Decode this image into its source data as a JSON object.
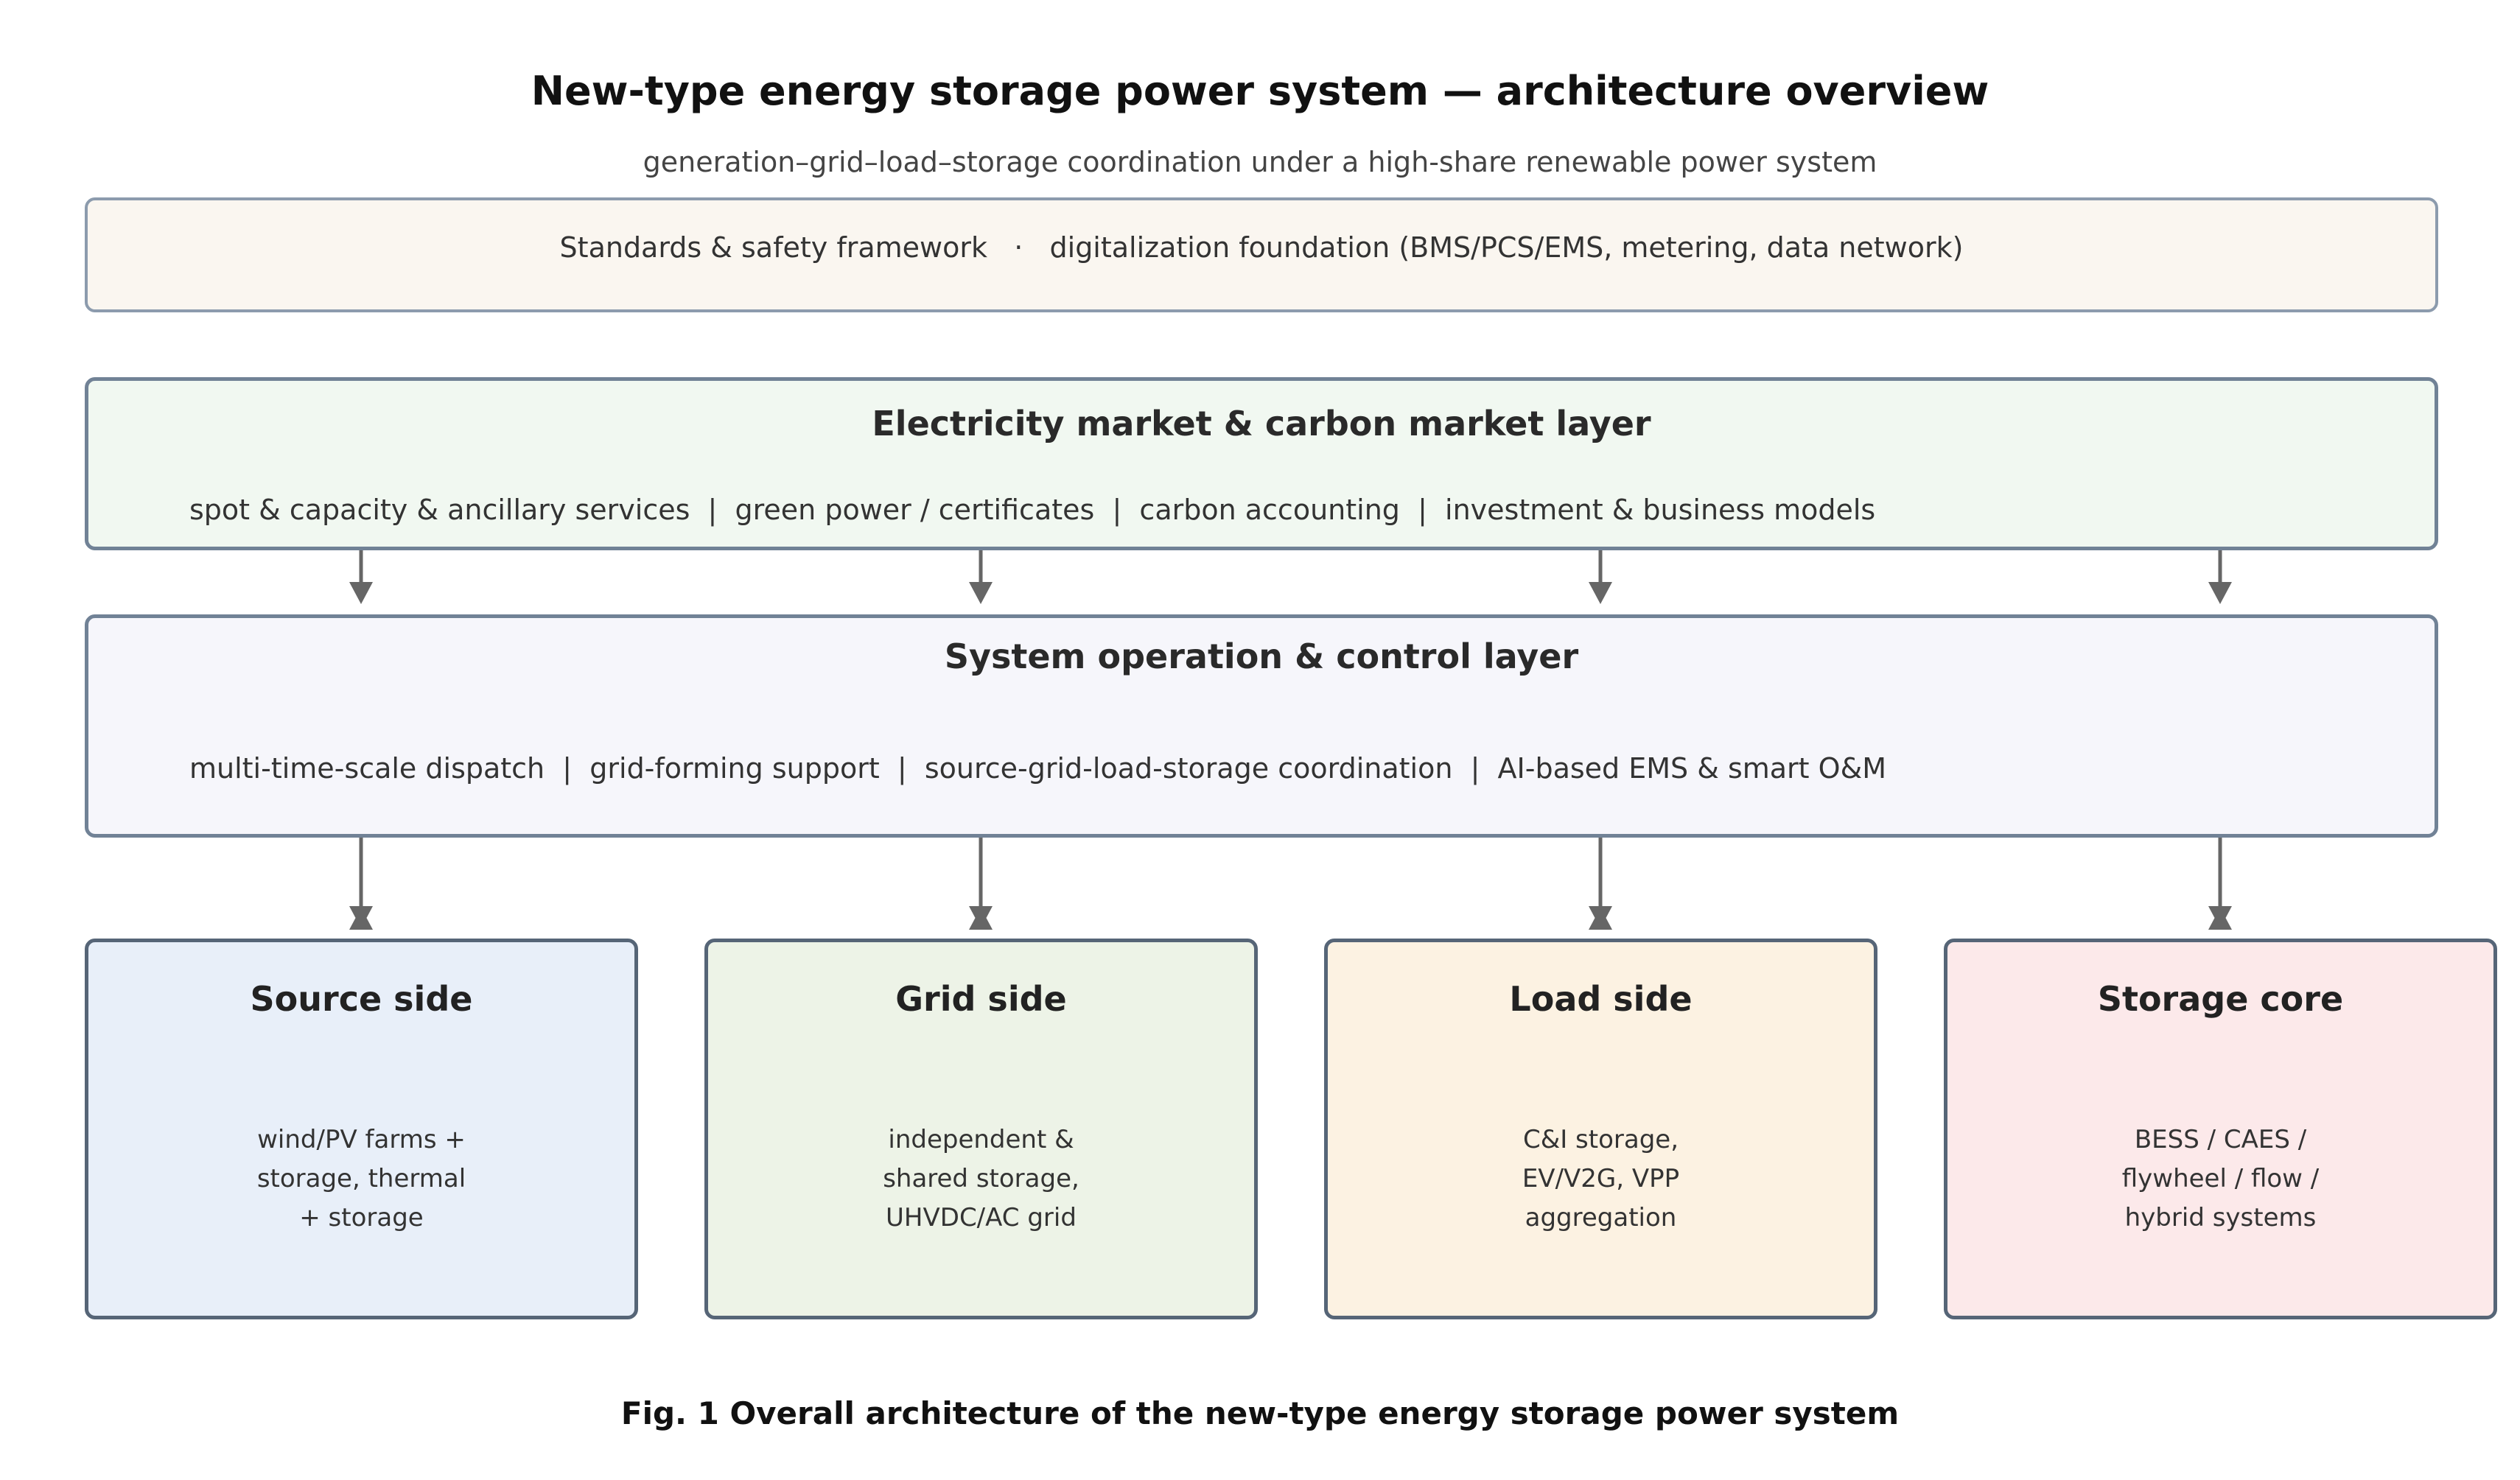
{
  "title": "New-type energy storage power system — architecture overview",
  "subtitle": "generation–grid–load–storage coordination under a high-share renewable power system",
  "foundation": {
    "text": "Standards & safety framework   ·   digitalization foundation (BMS/PCS/EMS, metering, data network)"
  },
  "market_layer": {
    "title": "Electricity market & carbon market layer",
    "items": "spot & capacity & ancillary services  |  green power / certificates  |  carbon accounting  |  investment & business models"
  },
  "operation_layer": {
    "title": "System operation & control layer",
    "items": "multi-time-scale dispatch  |  grid-forming support  |  source-grid-load-storage coordination  |  AI-based EMS & smart O&M"
  },
  "sides": [
    {
      "title": "Source side",
      "lines": [
        "wind/PV farms +",
        "storage, thermal",
        "+ storage"
      ]
    },
    {
      "title": "Grid side",
      "lines": [
        "independent &",
        "shared storage,",
        "UHVDC/AC grid"
      ]
    },
    {
      "title": "Load side",
      "lines": [
        "C&I storage,",
        "EV/V2G, VPP",
        "aggregation"
      ]
    },
    {
      "title": "Storage core",
      "lines": [
        "BESS / CAES /",
        "flywheel / flow /",
        "hybrid systems"
      ]
    }
  ],
  "arrow_color": "#666666",
  "caption": "Fig. 1  Overall architecture of the new-type energy storage power system"
}
